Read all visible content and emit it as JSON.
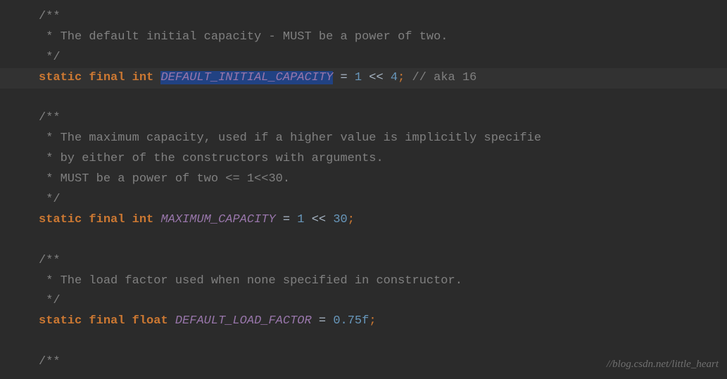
{
  "code": {
    "line1": "/**",
    "line2_prefix": " * ",
    "line2_text": "The default initial capacity - MUST be a power of two.",
    "line3": " */",
    "line4_static": "static",
    "line4_final": "final",
    "line4_type": "int",
    "line4_name": "DEFAULT_INITIAL_CAPACITY",
    "line4_eq": " = ",
    "line4_val1": "1",
    "line4_op": " << ",
    "line4_val2": "4",
    "line4_semi": ";",
    "line4_comment": " // aka 16",
    "line6": "/**",
    "line7_prefix": " * ",
    "line7_text": "The maximum capacity, used if a higher value is implicitly specifie",
    "line8_prefix": " * ",
    "line8_text": "by either of the constructors with arguments.",
    "line9_prefix": " * ",
    "line9_text": "MUST be a power of two <= 1<<30.",
    "line10": " */",
    "line11_static": "static",
    "line11_final": "final",
    "line11_type": "int",
    "line11_name": "MAXIMUM_CAPACITY",
    "line11_eq": " = ",
    "line11_val1": "1",
    "line11_op": " << ",
    "line11_val2": "30",
    "line11_semi": ";",
    "line13": "/**",
    "line14_prefix": " * ",
    "line14_text": "The load factor used when none specified in constructor.",
    "line15": " */",
    "line16_static": "static",
    "line16_final": "final",
    "line16_type": "float",
    "line16_name": "DEFAULT_LOAD_FACTOR",
    "line16_eq": " = ",
    "line16_val": "0.75f",
    "line16_semi": ";",
    "line18": "/**"
  },
  "watermark": "//blog.csdn.net/little_heart"
}
